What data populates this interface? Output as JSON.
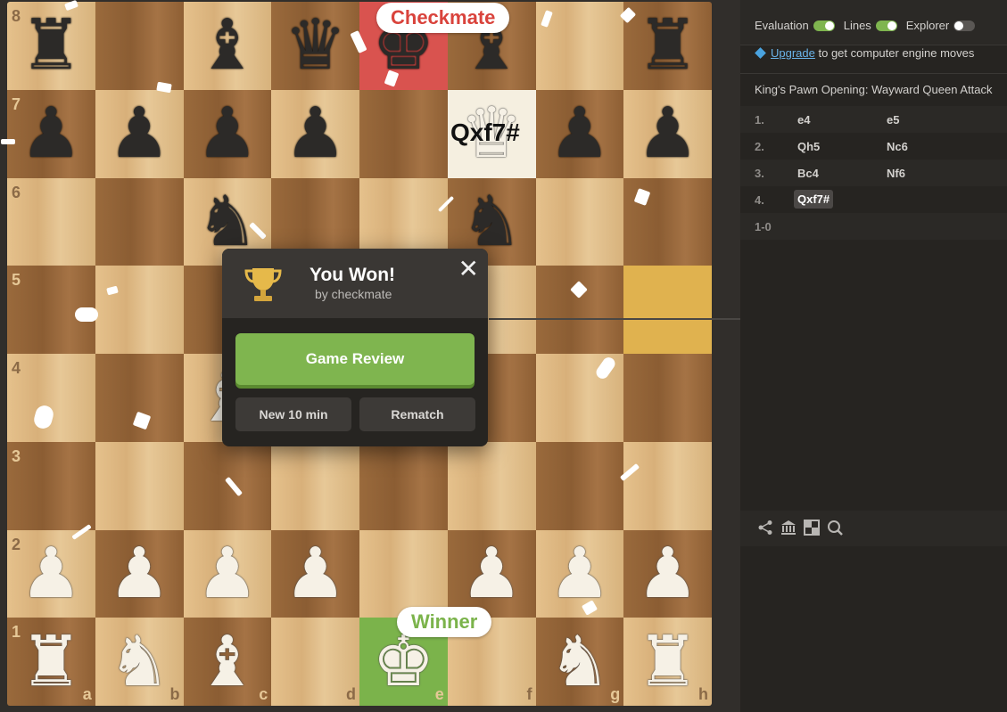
{
  "board": {
    "ranks": [
      "8",
      "7",
      "6",
      "5",
      "4",
      "3",
      "2",
      "1"
    ],
    "files": [
      "a",
      "b",
      "c",
      "d",
      "e",
      "f",
      "g",
      "h"
    ],
    "rows": [
      [
        "bR",
        "",
        "bB",
        "bQ",
        "bK",
        "bB",
        "",
        "bR"
      ],
      [
        "bP",
        "bP",
        "bP",
        "bP",
        "",
        "wQ",
        "bP",
        "bP"
      ],
      [
        "",
        "",
        "bN",
        "",
        "",
        "bN",
        "",
        ""
      ],
      [
        "",
        "",
        "",
        "",
        "bP",
        "",
        "",
        ""
      ],
      [
        "",
        "",
        "wB",
        "",
        "wP",
        "",
        "",
        ""
      ],
      [
        "",
        "",
        "",
        "",
        "",
        "",
        "",
        ""
      ],
      [
        "wP",
        "wP",
        "wP",
        "wP",
        "",
        "wP",
        "wP",
        "wP"
      ],
      [
        "wR",
        "wN",
        "wB",
        "",
        "wK",
        "",
        "wN",
        "wR"
      ]
    ],
    "highlights": {
      "e8": "red",
      "f7": "white",
      "h5": "yellow",
      "e1": "green"
    },
    "last_move_label": "Qxf7#",
    "checkmate_badge": "Checkmate",
    "winner_badge": "Winner"
  },
  "modal": {
    "title": "You Won!",
    "subtitle": "by checkmate",
    "close_label": "✕",
    "review_button": "Game Review",
    "new_game_button": "New 10 min",
    "rematch_button": "Rematch",
    "trophy_icon": "trophy-icon"
  },
  "panel": {
    "toggles": [
      {
        "label": "Evaluation",
        "on": true
      },
      {
        "label": "Lines",
        "on": true
      },
      {
        "label": "Explorer",
        "on": false
      }
    ],
    "upgrade_link": "Upgrade",
    "upgrade_text": "to get computer engine moves",
    "opening": "King's Pawn Opening: Wayward Queen Attack",
    "moves": [
      {
        "num": "1.",
        "white": "e4",
        "black": "e5"
      },
      {
        "num": "2.",
        "white": "Qh5",
        "black": "Nc6"
      },
      {
        "num": "3.",
        "white": "Bc4",
        "black": "Nf6"
      },
      {
        "num": "4.",
        "white": "Qxf7#",
        "black": ""
      }
    ],
    "result": "1-0"
  },
  "colors": {
    "accent_green": "#7fb54f",
    "check_red": "#d9534f"
  }
}
